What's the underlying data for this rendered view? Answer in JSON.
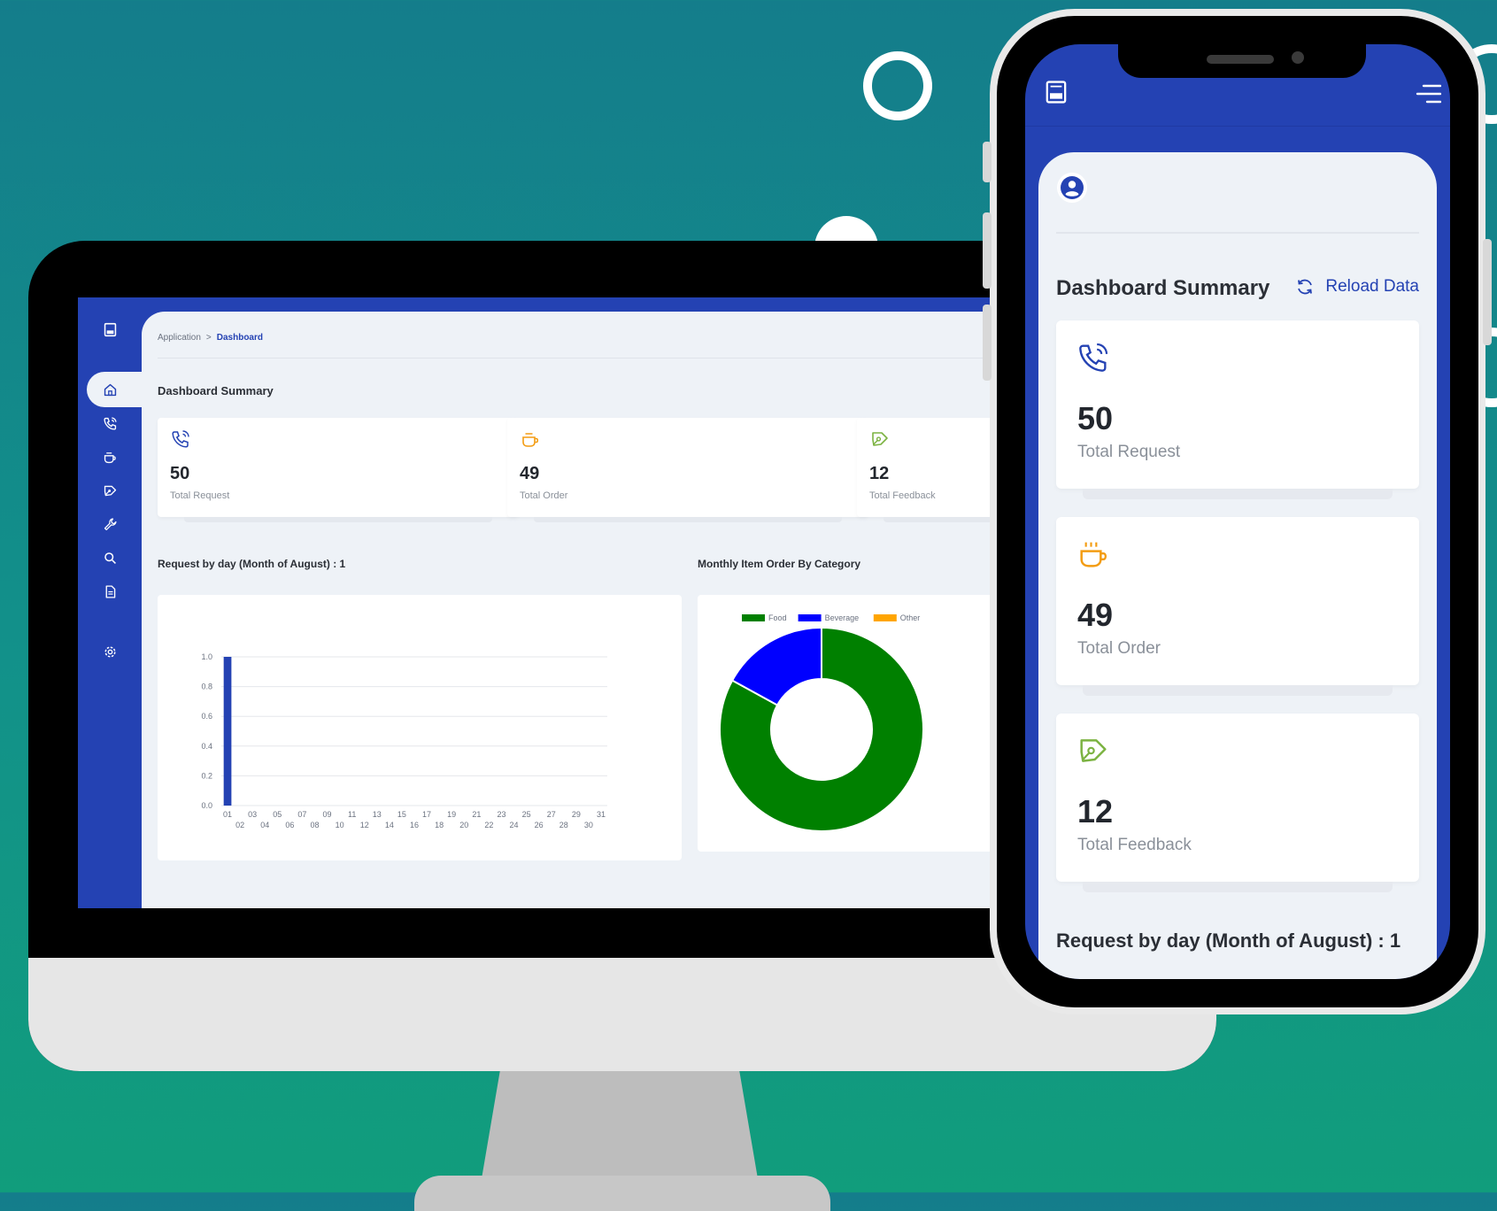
{
  "colors": {
    "primary": "#2442b3",
    "panel_bg": "#eef2f7",
    "request_icon": "#2442b3",
    "order_icon": "#f39c12",
    "feedback_icon": "#7cb342",
    "food": "#008000",
    "beverage": "#0000ff",
    "other": "#ffa500"
  },
  "desktop": {
    "breadcrumb": {
      "parent": "Application",
      "separator": ">",
      "current": "Dashboard"
    },
    "sidebar": {
      "items": [
        {
          "icon": "logo-icon"
        },
        {
          "icon": "home-icon",
          "active": true
        },
        {
          "icon": "phone-icon"
        },
        {
          "icon": "coffee-icon"
        },
        {
          "icon": "pen-icon"
        },
        {
          "icon": "wrench-icon"
        },
        {
          "icon": "search-icon"
        },
        {
          "icon": "document-icon"
        },
        {
          "icon": "gear-icon"
        }
      ]
    },
    "summary_title": "Dashboard Summary",
    "cards": [
      {
        "icon": "phone-icon",
        "value": "50",
        "label": "Total Request"
      },
      {
        "icon": "coffee-icon",
        "value": "49",
        "label": "Total Order"
      },
      {
        "icon": "pen-icon",
        "value": "12",
        "label": "Total Feedback"
      }
    ],
    "bar_chart_title": "Request by day (Month of August) : 1",
    "donut_chart_title": "Monthly Item Order By Category"
  },
  "phone": {
    "header_icons": [
      "logo-icon",
      "menu-icon"
    ],
    "user_icon": "user-circle-icon",
    "summary_title": "Dashboard Summary",
    "reload_label": "Reload Data",
    "cards": [
      {
        "icon": "phone-icon",
        "value": "50",
        "label": "Total Request"
      },
      {
        "icon": "coffee-icon",
        "value": "49",
        "label": "Total Order"
      },
      {
        "icon": "pen-icon",
        "value": "12",
        "label": "Total Feedback"
      }
    ],
    "chart_title": "Request by day (Month of August) : 1"
  },
  "chart_data": [
    {
      "type": "bar",
      "title": "Request by day (Month of August) : 1",
      "xlabel": "",
      "ylabel": "",
      "categories": [
        "01",
        "02",
        "03",
        "04",
        "05",
        "06",
        "07",
        "08",
        "09",
        "10",
        "11",
        "12",
        "13",
        "14",
        "15",
        "16",
        "17",
        "18",
        "19",
        "20",
        "21",
        "22",
        "23",
        "24",
        "25",
        "26",
        "27",
        "28",
        "29",
        "30",
        "31"
      ],
      "values": [
        1,
        0,
        0,
        0,
        0,
        0,
        0,
        0,
        0,
        0,
        0,
        0,
        0,
        0,
        0,
        0,
        0,
        0,
        0,
        0,
        0,
        0,
        0,
        0,
        0,
        0,
        0,
        0,
        0,
        0,
        0
      ],
      "ylim": [
        0,
        1.0
      ],
      "yticks": [
        "0.0",
        "0.2",
        "0.4",
        "0.6",
        "0.8",
        "1.0"
      ],
      "grid": true,
      "color": "#2442b3"
    },
    {
      "type": "pie",
      "donut": true,
      "title": "Monthly Item Order By Category",
      "legend_position": "top",
      "labels": [
        "Food",
        "Beverage",
        "Other"
      ],
      "values": [
        83,
        17,
        0
      ],
      "colors": [
        "#008000",
        "#0000ff",
        "#ffa500"
      ]
    }
  ]
}
